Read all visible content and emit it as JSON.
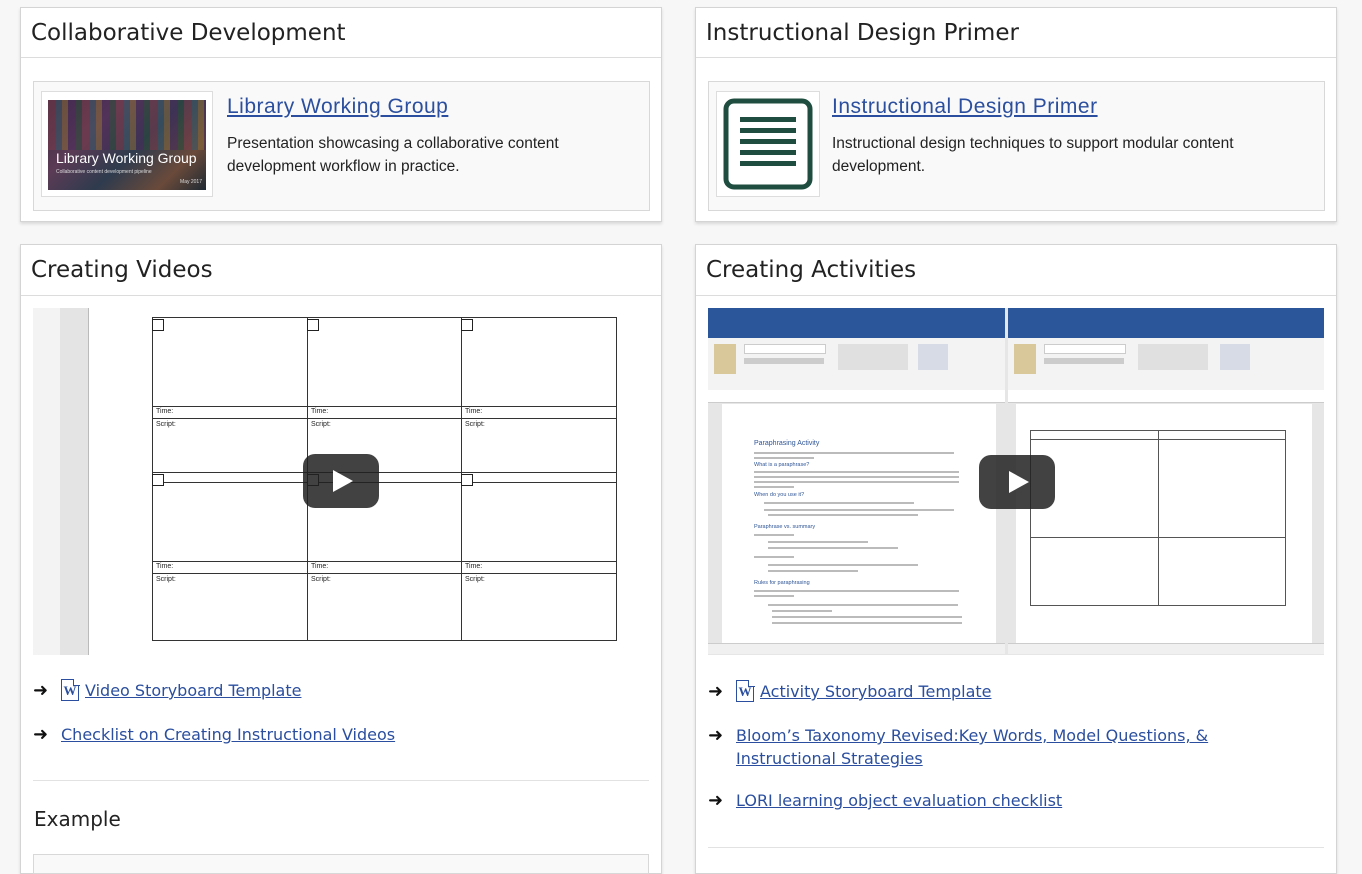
{
  "collab": {
    "heading": "Collaborative Development",
    "item": {
      "title": "Library Working Group",
      "description": "Presentation showcasing a collaborative content development workflow in practice.",
      "thumb_title": "Library Working Group",
      "thumb_subtitle": "Collaborative content development pipeline",
      "thumb_date": "May 2017"
    }
  },
  "primer": {
    "heading": "Instructional Design Primer",
    "item": {
      "title": "Instructional Design Primer",
      "description": "Instructional design techniques to support modular content development.",
      "icon": "document-lines-icon"
    }
  },
  "videos": {
    "heading": "Creating Videos",
    "storyboard": {
      "time_label": "Time:",
      "script_label": "Script:"
    },
    "links": [
      {
        "label": "Video Storyboard Template",
        "icon": "word-doc-icon"
      },
      {
        "label": "Checklist on Creating Instructional Videos"
      }
    ],
    "example_heading": "Example"
  },
  "activities": {
    "heading": "Creating Activities",
    "links": [
      {
        "label": "Activity Storyboard Template",
        "icon": "word-doc-icon"
      },
      {
        "label": "Bloom’s Taxonomy Revised:Key Words, Model Questions, & Instructional Strategies"
      },
      {
        "label": "LORI learning object evaluation checklist"
      }
    ],
    "left_doc": {
      "title": "Paraphrasing Activity",
      "h1": "What is a paraphrase?",
      "h2": "When do you use it?",
      "h3": "Paraphrase vs. summary",
      "h4": "Rules for paraphrasing"
    }
  },
  "colors": {
    "link": "#2b4f9e",
    "word_blue": "#2b579a",
    "icon_green": "#1f4d3f"
  }
}
